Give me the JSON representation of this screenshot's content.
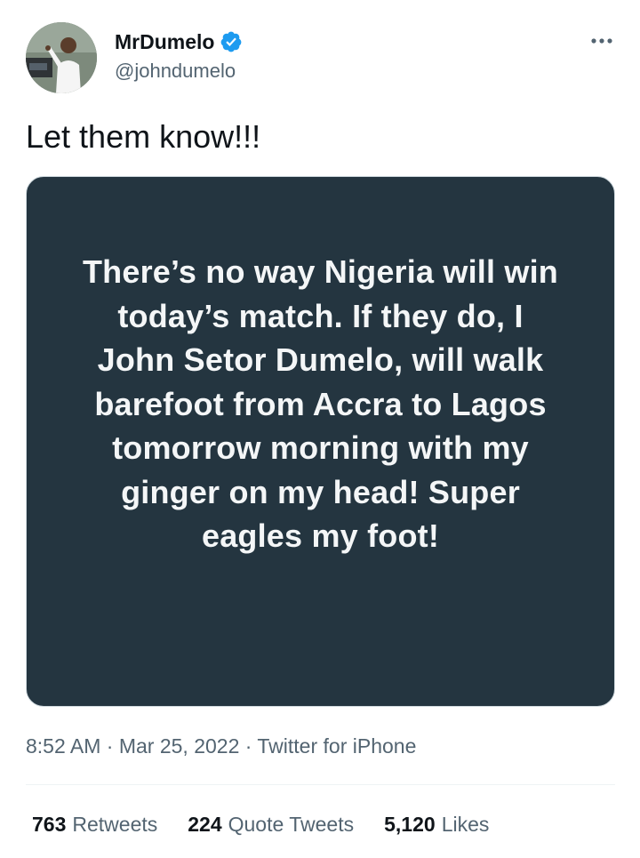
{
  "author": {
    "display_name": "MrDumelo",
    "handle": "@johndumelo",
    "verified": true,
    "verified_icon": "verified-badge-icon"
  },
  "tweet": {
    "text": "Let them know!!!",
    "image_text": "There’s no way Nigeria will win today’s match. If they do, I John Setor Dumelo, will walk barefoot from Accra to Lagos tomorrow morning with my ginger on my head! Super eagles my foot!",
    "image_lines": [
      "There’s no way Nigeria will win",
      "today’s match. If they do, I",
      "John Setor Dumelo, will walk",
      "barefoot from Accra to Lagos",
      "tomorrow morning with my",
      "ginger on my head! Super",
      "eagles my foot!"
    ]
  },
  "meta": {
    "time": "8:52 AM",
    "separator": " · ",
    "date": "Mar 25, 2022",
    "source": "Twitter for iPhone"
  },
  "stats": {
    "retweets": {
      "count": "763",
      "label": "Retweets"
    },
    "quotes": {
      "count": "224",
      "label": "Quote Tweets"
    },
    "likes": {
      "count": "5,120",
      "label": "Likes"
    }
  },
  "colors": {
    "accent": "#1d9bf0",
    "text_primary": "#0f1419",
    "text_secondary": "#536471",
    "image_background": "#243540",
    "image_text": "#f4f6f7"
  }
}
